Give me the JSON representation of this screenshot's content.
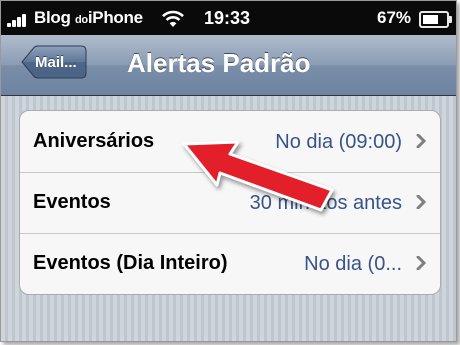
{
  "status_bar": {
    "carrier_prefix": "Blog",
    "carrier_small": "do",
    "carrier_suffix": "iPhone",
    "time": "19:33",
    "battery_percent_text": "67%",
    "battery_level": 0.67,
    "signal_icon": "signal-bars-icon",
    "wifi_icon": "wifi-icon"
  },
  "nav": {
    "back_label": "Mail...",
    "title": "Alertas Padrão"
  },
  "rows": [
    {
      "label": "Aniversários",
      "value": "No dia (09:00)"
    },
    {
      "label": "Eventos",
      "value": "30 minutos antes"
    },
    {
      "label": "Eventos (Dia Inteiro)",
      "value": "No dia (0..."
    }
  ],
  "annotation": {
    "arrow_color": "#e3202a",
    "arrow_icon": "red-pointer-arrow"
  },
  "colors": {
    "nav_bar": "#7a8ea9",
    "value_text": "#385487"
  }
}
